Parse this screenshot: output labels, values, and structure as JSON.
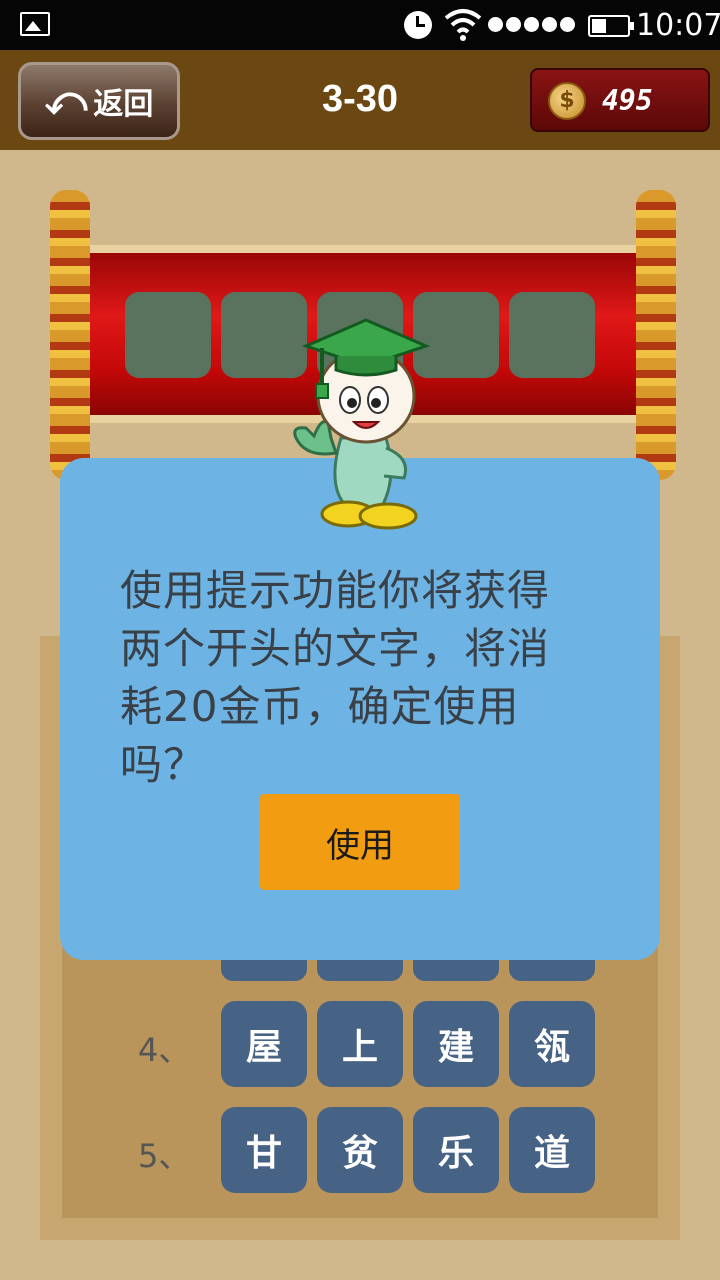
{
  "status_bar": {
    "time": "10:07"
  },
  "header": {
    "back_label": "返回",
    "level": "3-30",
    "coins": "495"
  },
  "answer_slots": 5,
  "board": {
    "rows": [
      {
        "num": "4、",
        "tiles": [
          "屋",
          "上",
          "建",
          "瓴"
        ]
      },
      {
        "num": "5、",
        "tiles": [
          "甘",
          "贫",
          "乐",
          "道"
        ]
      }
    ]
  },
  "dialog": {
    "message": "使用提示功能你将获得两个开头的文字，将消耗20金币，确定使用吗？",
    "use_button": "使用"
  },
  "colors": {
    "topbar": "#6b4712",
    "dialog": "#6db4e4",
    "tile": "#466285",
    "button": "#f29c12"
  }
}
